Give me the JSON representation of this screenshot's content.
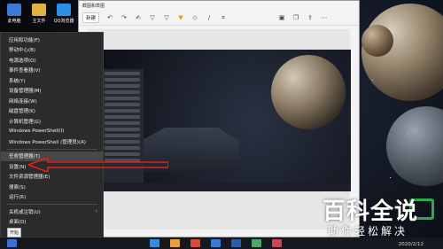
{
  "desktop": {
    "icons": [
      {
        "label": "此电脑",
        "color": "#3a7bd5"
      },
      {
        "label": "主文件",
        "color": "#e3b23c"
      },
      {
        "label": "QQ浏览器",
        "color": "#2c8fe8"
      }
    ]
  },
  "editor": {
    "title": "截图和草图",
    "new_label": "新建",
    "tools": [
      "undo-icon",
      "redo-icon",
      "touch-write-icon",
      "ballpoint-pen-icon",
      "pencil-icon",
      "highlighter-icon",
      "eraser-icon",
      "ruler-icon",
      "crop-icon",
      "save-icon",
      "copy-icon",
      "share-icon",
      "more-icon"
    ]
  },
  "winx_menu": {
    "items": [
      {
        "label": "应用和功能(F)"
      },
      {
        "label": "移动中心(B)"
      },
      {
        "label": "电源选项(O)"
      },
      {
        "label": "事件查看器(V)"
      },
      {
        "label": "系统(Y)"
      },
      {
        "label": "设备管理器(M)"
      },
      {
        "label": "网络连接(W)"
      },
      {
        "label": "磁盘管理(K)"
      },
      {
        "label": "计算机管理(G)"
      },
      {
        "label": "Windows PowerShell(I)"
      },
      {
        "label": "Windows PowerShell (管理员)(A)"
      },
      {
        "label": "任务管理器(T)",
        "selected": true
      },
      {
        "label": "设置(N)"
      },
      {
        "label": "文件资源管理器(E)"
      },
      {
        "label": "搜索(S)"
      },
      {
        "label": "运行(R)"
      },
      {
        "label": "关机或注销(U)",
        "submenu": true
      },
      {
        "label": "桌面(D)"
      }
    ]
  },
  "taskbar": {
    "start_tooltip": "开始",
    "apps": [
      "#3b6fd6",
      "#2c8fe8",
      "#e3a23c",
      "#d84a3a",
      "#3a7bd5",
      "#2b5ea8",
      "#4aa86a",
      "#cc4455"
    ],
    "date": "2020/2/12"
  },
  "watermark": {
    "main": "百科全说",
    "sub": "助你轻松解决",
    "accent": "#2fa84f"
  }
}
